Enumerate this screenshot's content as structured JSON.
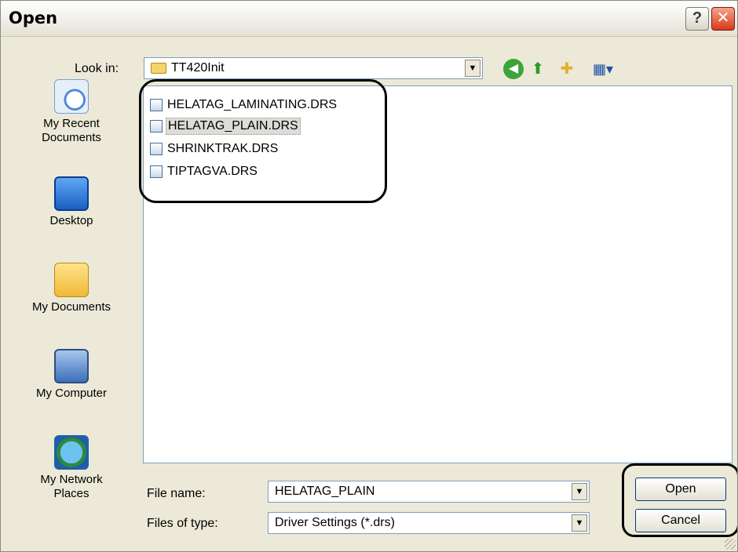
{
  "window": {
    "title": "Open",
    "help_label": "?",
    "close_label": "✕"
  },
  "look_in": {
    "label": "Look in:",
    "value": "TT420Init"
  },
  "toolbar": {
    "icons": [
      "back-icon",
      "up-folder-icon",
      "new-folder-icon",
      "views-menu-icon"
    ]
  },
  "places": {
    "items": [
      {
        "label_line1": "My Recent",
        "label_line2": "Documents",
        "icon": "recent-documents-icon"
      },
      {
        "label_line1": "Desktop",
        "icon": "desktop-icon"
      },
      {
        "label_line1": "My Documents",
        "icon": "my-documents-icon"
      },
      {
        "label_line1": "My Computer",
        "icon": "my-computer-icon"
      },
      {
        "label_line1": "My Network",
        "label_line2": "Places",
        "icon": "network-places-icon"
      }
    ]
  },
  "files": [
    {
      "name": "HELATAG_LAMINATING.DRS",
      "selected": false
    },
    {
      "name": "HELATAG_PLAIN.DRS",
      "selected": true
    },
    {
      "name": "SHRINKTRAK.DRS",
      "selected": false
    },
    {
      "name": "TIPTAGVA.DRS",
      "selected": false
    }
  ],
  "file_name": {
    "label": "File name:",
    "value": "HELATAG_PLAIN"
  },
  "file_type": {
    "label": "Files of type:",
    "value": "Driver Settings (*.drs)"
  },
  "buttons": {
    "open": "Open",
    "cancel": "Cancel"
  },
  "colors": {
    "dialog_bg": "#ece9d8",
    "field_border": "#7f9db9",
    "close_red": "#d6391a"
  }
}
